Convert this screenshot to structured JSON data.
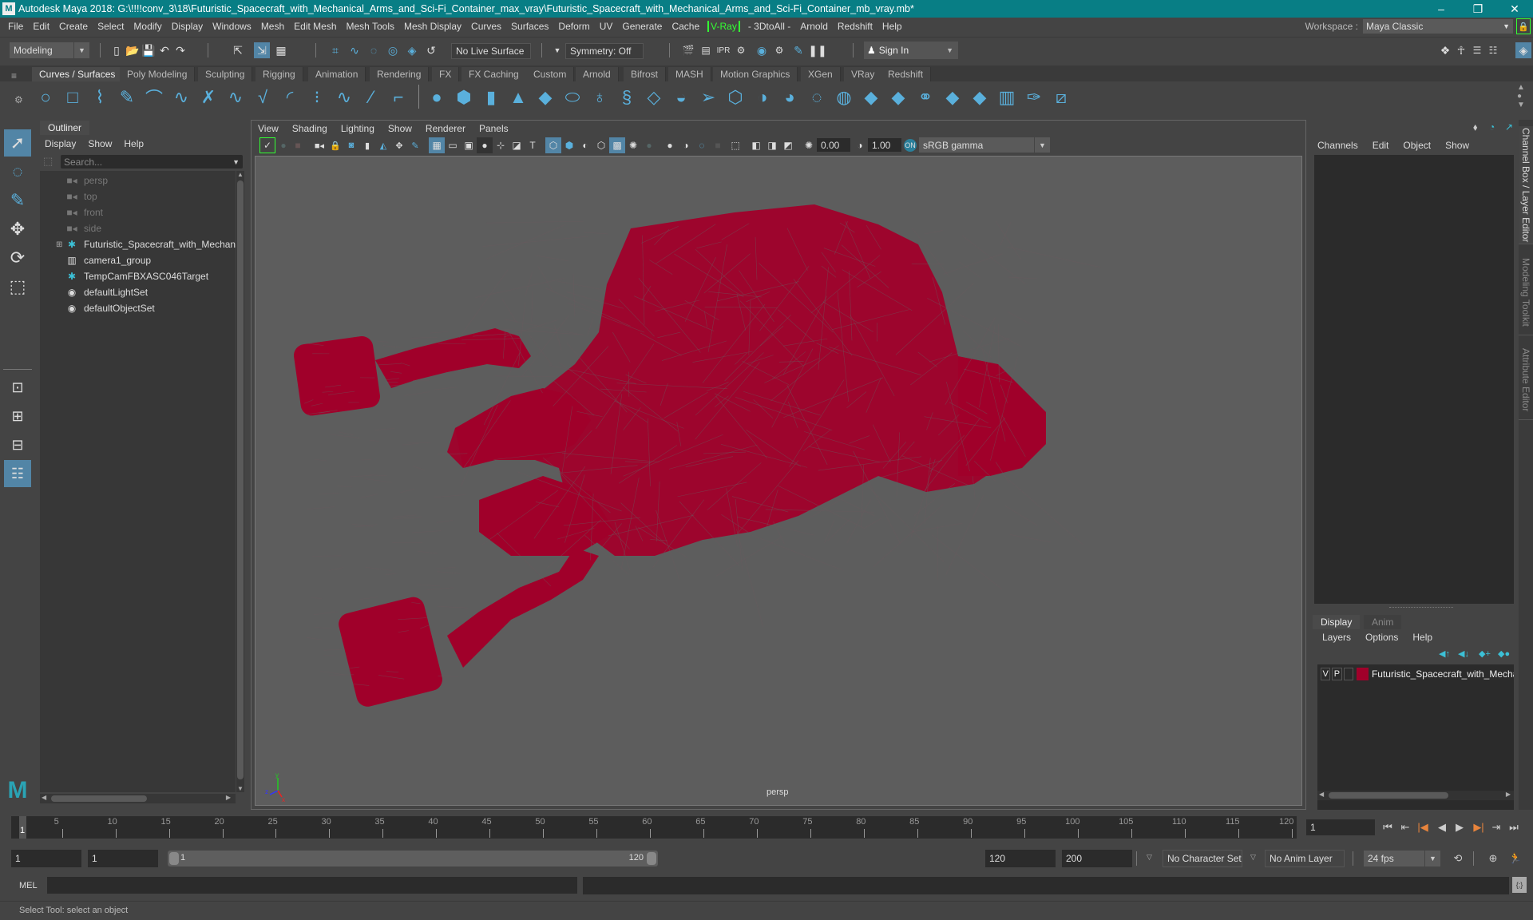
{
  "title_bar": {
    "title": "Autodesk Maya 2018: G:\\!!!!conv_3\\18\\Futuristic_Spacecraft_with_Mechanical_Arms_and_Sci-Fi_Container_max_vray\\Futuristic_Spacecraft_with_Mechanical_Arms_and_Sci-Fi_Container_mb_vray.mb*",
    "logo": "M",
    "minimize": "–",
    "restore": "❐",
    "close": "✕"
  },
  "menu_bar": {
    "items": [
      "File",
      "Edit",
      "Create",
      "Select",
      "Modify",
      "Display",
      "Windows",
      "Mesh",
      "Edit Mesh",
      "Mesh Tools",
      "Mesh Display",
      "Curves",
      "Surfaces",
      "Deform",
      "UV",
      "Generate",
      "Cache"
    ],
    "vray": "V-Ray",
    "items_after": [
      "- 3DtoAll -",
      "Arnold",
      "Redshift",
      "Help"
    ],
    "workspace_label": "Workspace :",
    "workspace_value": "Maya Classic"
  },
  "status_line": {
    "mode": "Modeling",
    "live_surface": "No Live Surface",
    "symmetry": "Symmetry: Off",
    "sign_in": "Sign In"
  },
  "shelf": {
    "tabs": [
      "Curves / Surfaces",
      "Poly Modeling",
      "Sculpting",
      "Rigging",
      "Animation",
      "Rendering",
      "FX",
      "FX Caching",
      "Custom",
      "Arnold",
      "Bifrost",
      "MASH",
      "Motion Graphics",
      "XGen",
      "VRay",
      "Redshift"
    ],
    "active_tab": 0,
    "curve_tools": [
      "circle",
      "square",
      "ep-curve",
      "pencil-curve",
      "cv-curve",
      "bezier",
      "intersect",
      "rebuild",
      "extend",
      "offset",
      "arc",
      "attach",
      "detach",
      "cut",
      "fillet"
    ],
    "surface_tools": [
      "sphere",
      "cube",
      "cylinder",
      "cone",
      "diamond",
      "torus",
      "revolve",
      "loft",
      "planar",
      "extrude",
      "birail",
      "boundary",
      "square-surface",
      "bevel",
      "project",
      "intersect",
      "trim",
      "untrim",
      "stitch",
      "sculpt",
      "insert-isoparm",
      "dup-curve"
    ]
  },
  "outliner": {
    "tab": "Outliner",
    "menu": [
      "Display",
      "Show",
      "Help"
    ],
    "search_placeholder": "Search...",
    "items": [
      {
        "label": "persp",
        "icon": "camera-icon",
        "dim": true
      },
      {
        "label": "top",
        "icon": "camera-icon",
        "dim": true
      },
      {
        "label": "front",
        "icon": "camera-icon",
        "dim": true
      },
      {
        "label": "side",
        "icon": "camera-icon",
        "dim": true
      },
      {
        "label": "Futuristic_Spacecraft_with_Mechanical_Arms_and_Sci-Fi_Container",
        "icon": "locator-icon",
        "dim": false,
        "expandable": true
      },
      {
        "label": "camera1_group",
        "icon": "group-icon",
        "dim": false
      },
      {
        "label": "TempCamFBXASC046Target",
        "icon": "locator-icon",
        "dim": false
      },
      {
        "label": "defaultLightSet",
        "icon": "set-icon",
        "dim": false
      },
      {
        "label": "defaultObjectSet",
        "icon": "set-icon",
        "dim": false
      }
    ]
  },
  "viewport": {
    "menu": [
      "View",
      "Shading",
      "Lighting",
      "Show",
      "Renderer",
      "Panels"
    ],
    "exposure": "0.00",
    "gamma": "1.00",
    "color_space": "sRGB gamma",
    "camera_label": "persp",
    "wire_color": "#a0002a",
    "axis": {
      "x": "x",
      "y": "y",
      "z": "z"
    }
  },
  "channel_box": {
    "menu": [
      "Channels",
      "Edit",
      "Object",
      "Show"
    ],
    "layer_tabs": [
      "Display",
      "Anim"
    ],
    "layer_menu": [
      "Layers",
      "Options",
      "Help"
    ],
    "layer": {
      "v": "V",
      "p": "P",
      "name": "Futuristic_Spacecraft_with_Mechanical_Arms_and_Sci-Fi_Container",
      "color": "#a0002a"
    },
    "side_tabs": [
      "Channel Box / Layer Editor",
      "Modeling Toolkit",
      "Attribute Editor"
    ]
  },
  "time_slider": {
    "ticks": [
      5,
      10,
      15,
      20,
      25,
      30,
      35,
      40,
      45,
      50,
      55,
      60,
      65,
      70,
      75,
      80,
      85,
      90,
      95,
      100,
      105,
      110,
      115,
      120
    ],
    "min": 1,
    "max": 120,
    "current_frame_marker": "1",
    "current_frame": "1"
  },
  "range_slider": {
    "start": "1",
    "anim_start": "1",
    "range_start": "1",
    "range_end": "120",
    "end": "120",
    "anim_end": "200",
    "character_set": "No Character Set",
    "anim_layer": "No Anim Layer",
    "fps": "24 fps"
  },
  "command_line": {
    "label": "MEL",
    "value": ""
  },
  "help_line": {
    "text": "Select Tool: select an object"
  }
}
